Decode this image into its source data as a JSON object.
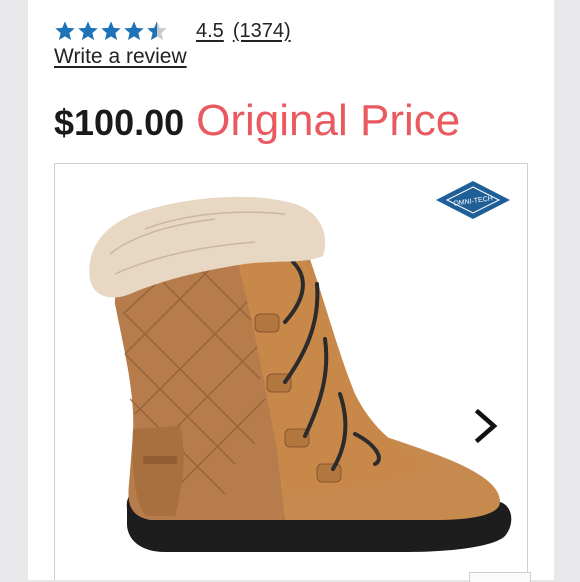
{
  "rating": {
    "value": "4.5",
    "count": "(1374)",
    "stars_filled": 4.5,
    "stars_total": 5,
    "star_color": "#1e73b8",
    "write_review_label": "Write a review"
  },
  "price": {
    "amount": "$100.00",
    "label": "Original Price",
    "label_color": "#e85a5f"
  },
  "product_image": {
    "badge_text": "OMNI-TECH",
    "icon": "boot-image",
    "next_icon": "chevron-right-icon"
  }
}
